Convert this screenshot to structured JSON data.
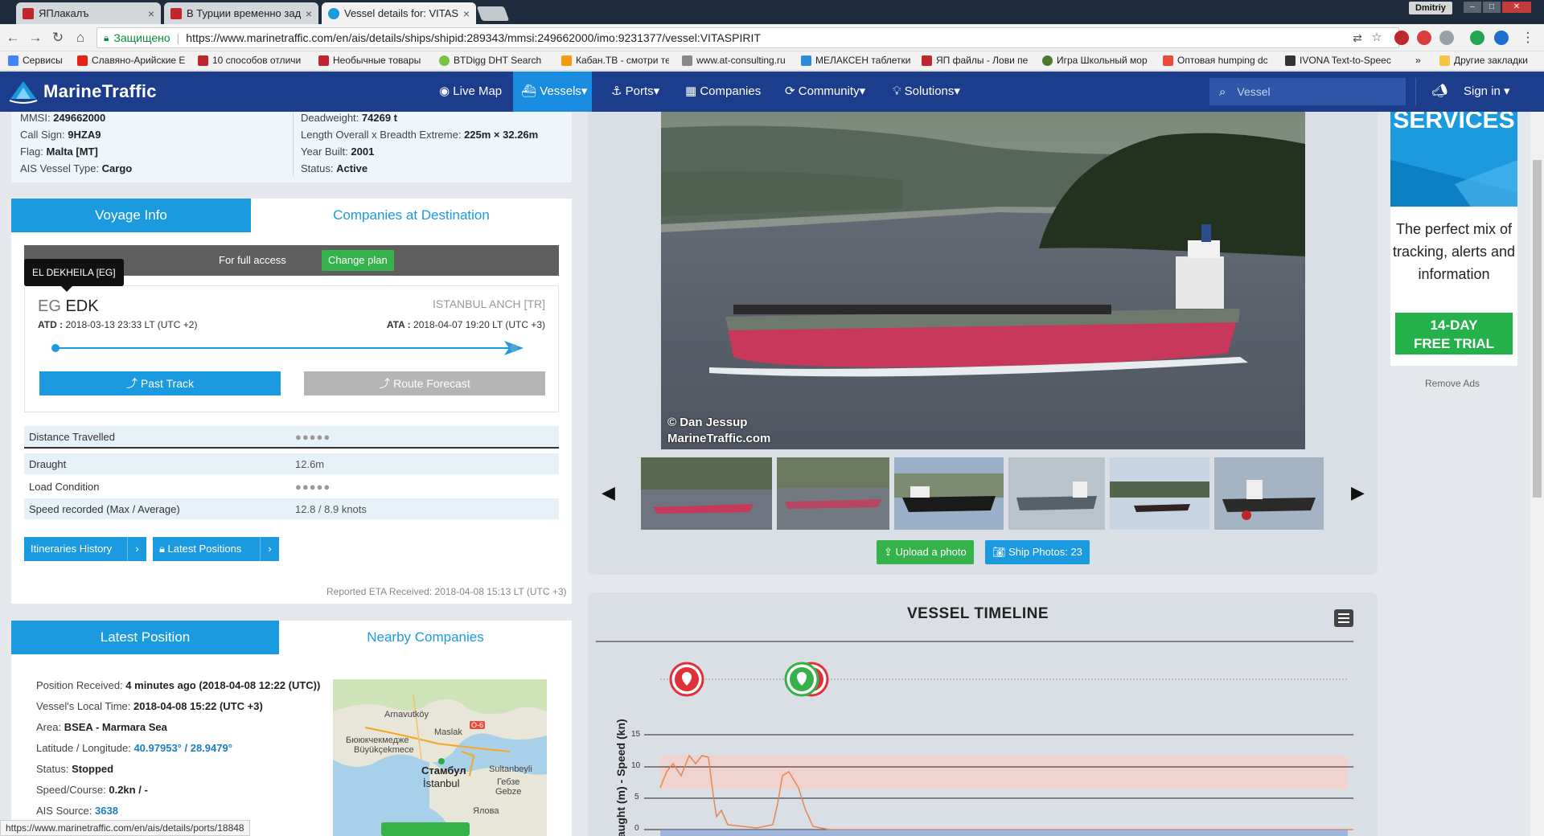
{
  "browser": {
    "tabs": [
      {
        "title": "ЯПлакалъ",
        "active": false
      },
      {
        "title": "В Турции временно зад",
        "active": false
      },
      {
        "title": "Vessel details for: VITASP",
        "active": true
      }
    ],
    "user": "Dmitriy",
    "secure_label": "Защищено",
    "url": "https://www.marinetraffic.com/en/ais/details/ships/shipid:289343/mmsi:249662000/imo:9231377/vessel:VITASPIRIT",
    "bookmarks": [
      "Сервисы",
      "Славяно-Арийские Е",
      "10 способов отличи",
      "Необычные товары",
      "BTDigg DHT Search E",
      "Кабан.ТВ - смотри те",
      "www.at-consulting.ru",
      "МЕЛАКСЕН таблетки",
      "ЯП файлы - Лови пе",
      "Игра Школьный мор",
      "Оптовая humping dc",
      "IVONA Text-to-Speec"
    ],
    "bookmarks_more": "»",
    "other_bookmarks": "Другие закладки",
    "status_url": "https://www.marinetraffic.com/en/ais/details/ports/18848"
  },
  "site": {
    "brand": "MarineTraffic",
    "nav": [
      "Live Map",
      "Vessels",
      "Ports",
      "Companies",
      "Community",
      "Solutions"
    ],
    "search_placeholder": "Vessel",
    "signin": "Sign in"
  },
  "vessel": {
    "left": [
      {
        "k": "MMSI:",
        "v": "249662000"
      },
      {
        "k": "Call Sign:",
        "v": "9HZA9"
      },
      {
        "k": "Flag:",
        "v": "Malta [MT]"
      },
      {
        "k": "AIS Vessel Type:",
        "v": "Cargo"
      }
    ],
    "right": [
      {
        "k": "Deadweight:",
        "v": "74269 t"
      },
      {
        "k": "Length Overall x Breadth Extreme:",
        "v": "225m × 32.26m"
      },
      {
        "k": "Year Built:",
        "v": "2001"
      },
      {
        "k": "Status:",
        "v": "Active"
      }
    ]
  },
  "voyage": {
    "tab_voyage": "Voyage Info",
    "tab_companies": "Companies at Destination",
    "full_access": "For full access",
    "change_plan": "Change plan",
    "tooltip": "EL DEKHEILA [EG]",
    "origin_country": "EG",
    "origin_code": "EDK",
    "dest": "ISTANBUL ANCH [TR]",
    "atd_label": "ATD :",
    "atd": "2018-03-13 23:33 LT (UTC +2)",
    "ata_label": "ATA :",
    "ata": "2018-04-07 19:20 LT (UTC +3)",
    "past_track": "Past Track",
    "route_forecast": "Route Forecast",
    "rows": [
      {
        "label": "Distance Travelled",
        "value": "●●●●●"
      },
      {
        "label": "Draught",
        "value": "12.6m"
      },
      {
        "label": "Load Condition",
        "value": "●●●●●"
      },
      {
        "label": "Speed recorded (Max / Average)",
        "value": "12.8 / 8.9 knots"
      }
    ],
    "itineraries": "Itineraries History",
    "latest_positions": "Latest Positions",
    "reported_eta": "Reported ETA Received: 2018-04-08 15:13 LT (UTC +3)"
  },
  "position": {
    "tab_latest": "Latest Position",
    "tab_nearby": "Nearby Companies",
    "rows": [
      {
        "k": "Position Received:",
        "v": "4 minutes ago (2018-04-08 12:22 (UTC))"
      },
      {
        "k": "Vessel's Local Time:",
        "v": "2018-04-08 15:22 (UTC +3)"
      },
      {
        "k": "Area:",
        "v": "BSEA - Marmara Sea"
      },
      {
        "k": "Latitude / Longitude:",
        "v": "40.97953° / 28.9479°"
      },
      {
        "k": "Status:",
        "v": "Stopped"
      },
      {
        "k": "Speed/Course:",
        "v": "0.2kn / -"
      },
      {
        "k": "AIS Source:",
        "v": "3638"
      }
    ],
    "map_labels": [
      "Arnavutköy",
      "Maslak",
      "Бююкчекмедже",
      "Büyükçekmece",
      "Стамбул",
      "İstanbul",
      "Sultanbeyli",
      "Гебзе",
      "Gebze",
      "Ялова",
      "O-6"
    ]
  },
  "photos": {
    "credit_line1": "© Dan Jessup",
    "credit_line2": "MarineTraffic.com",
    "upload": "Upload a photo",
    "ship_photos": "Ship Photos: 23"
  },
  "timeline": {
    "title": "VESSEL TIMELINE",
    "yaxis": "Draught (m) - Speed (kn)",
    "yticks": [
      "15",
      "10",
      "5",
      "0"
    ]
  },
  "ad": {
    "services": "SERVICES",
    "message": "The perfect mix of tracking, alerts and information",
    "trial_line1": "14-DAY",
    "trial_line2": "FREE TRIAL",
    "remove": "Remove Ads"
  },
  "colors": {
    "navbar": "#1c3d8c",
    "accent": "#1b9ae0",
    "green": "#36b24a"
  }
}
